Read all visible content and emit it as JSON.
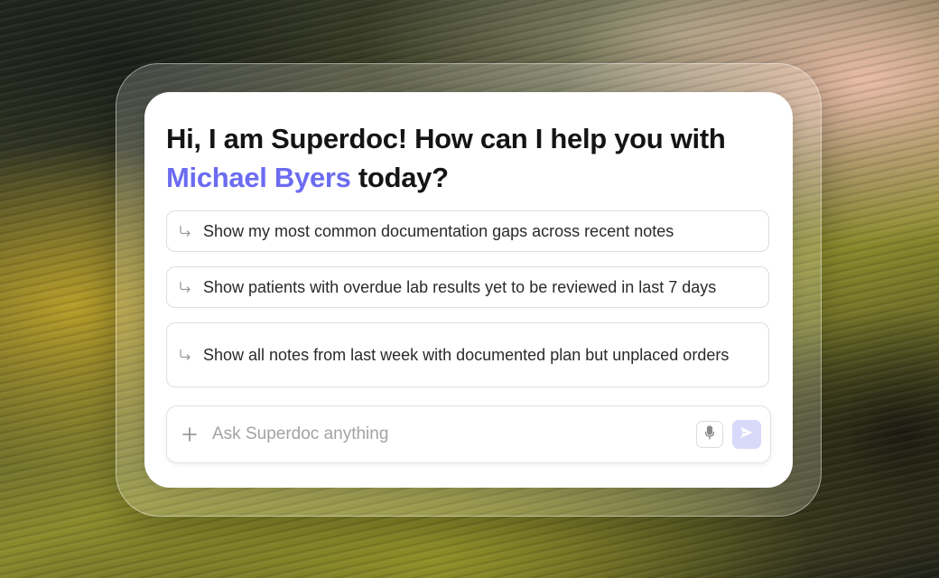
{
  "greeting": {
    "prefix": "Hi, I am Superdoc! How can I help you with ",
    "patient_name": "Michael Byers",
    "suffix": " today?"
  },
  "suggestions": [
    {
      "label": "Show my most common documentation gaps across recent notes",
      "icon": "return-arrow-icon"
    },
    {
      "label": "Show patients with overdue lab results yet to be reviewed in last 7 days",
      "icon": "return-arrow-icon"
    },
    {
      "label": "Show all notes from last week with documented plan but unplaced orders",
      "icon": "return-arrow-icon"
    }
  ],
  "input": {
    "placeholder": "Ask Superdoc anything",
    "value": "",
    "add_icon": "plus-icon",
    "mic_icon": "microphone-icon",
    "send_icon": "send-icon"
  },
  "colors": {
    "accent": "#6b6cf0",
    "send_button_bg": "#d9d9fb",
    "send_icon": "#ffffff",
    "text": "#141414"
  }
}
